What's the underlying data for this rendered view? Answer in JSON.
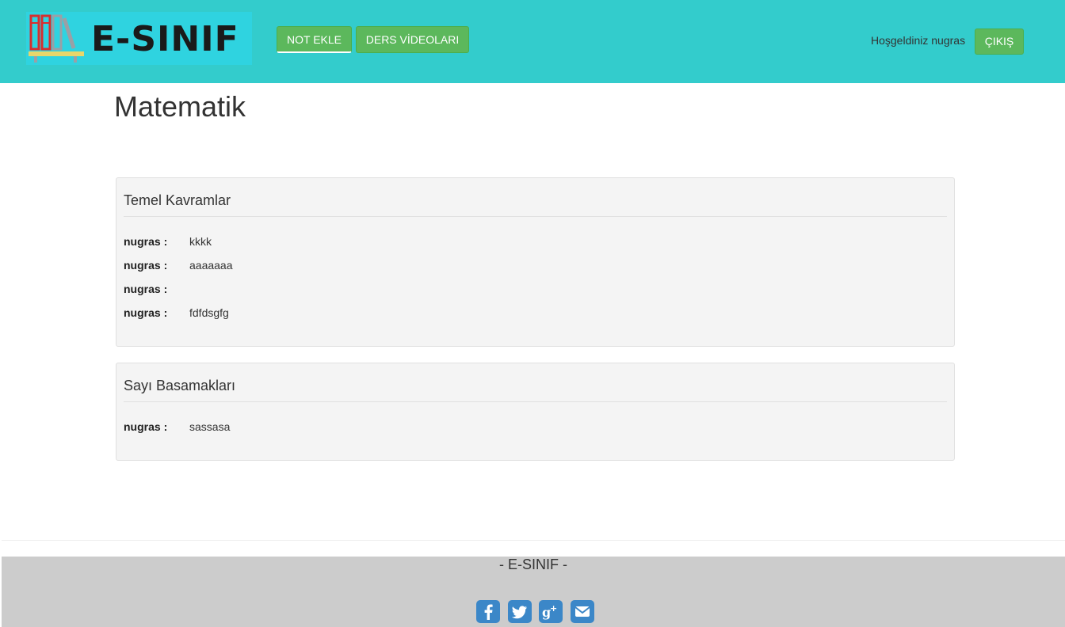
{
  "header": {
    "logo_text": "E-SINIF",
    "nav": [
      {
        "label": "NOT EKLE"
      },
      {
        "label": "DERS VİDEOLARI"
      }
    ],
    "welcome": "Hoşgeldiniz nugras",
    "logout_label": "ÇIKIŞ"
  },
  "page": {
    "title": "Matematik"
  },
  "panels": [
    {
      "title": "Temel Kavramlar",
      "notes": [
        {
          "user": "nugras :",
          "text": "kkkk"
        },
        {
          "user": "nugras :",
          "text": "aaaaaaa"
        },
        {
          "user": "nugras :",
          "text": ""
        },
        {
          "user": "nugras :",
          "text": "fdfdsgfg"
        }
      ]
    },
    {
      "title": "Sayı Basamakları",
      "notes": [
        {
          "user": "nugras :",
          "text": "sassasa"
        }
      ]
    }
  ],
  "footer": {
    "title": "- E-SINIF -",
    "social": [
      "facebook-icon",
      "twitter-icon",
      "google-plus-icon",
      "email-icon"
    ]
  },
  "colors": {
    "navbar": "#33cccc",
    "button": "#5cb85c",
    "footer": "#cccccc",
    "social": "#3b87c8"
  }
}
